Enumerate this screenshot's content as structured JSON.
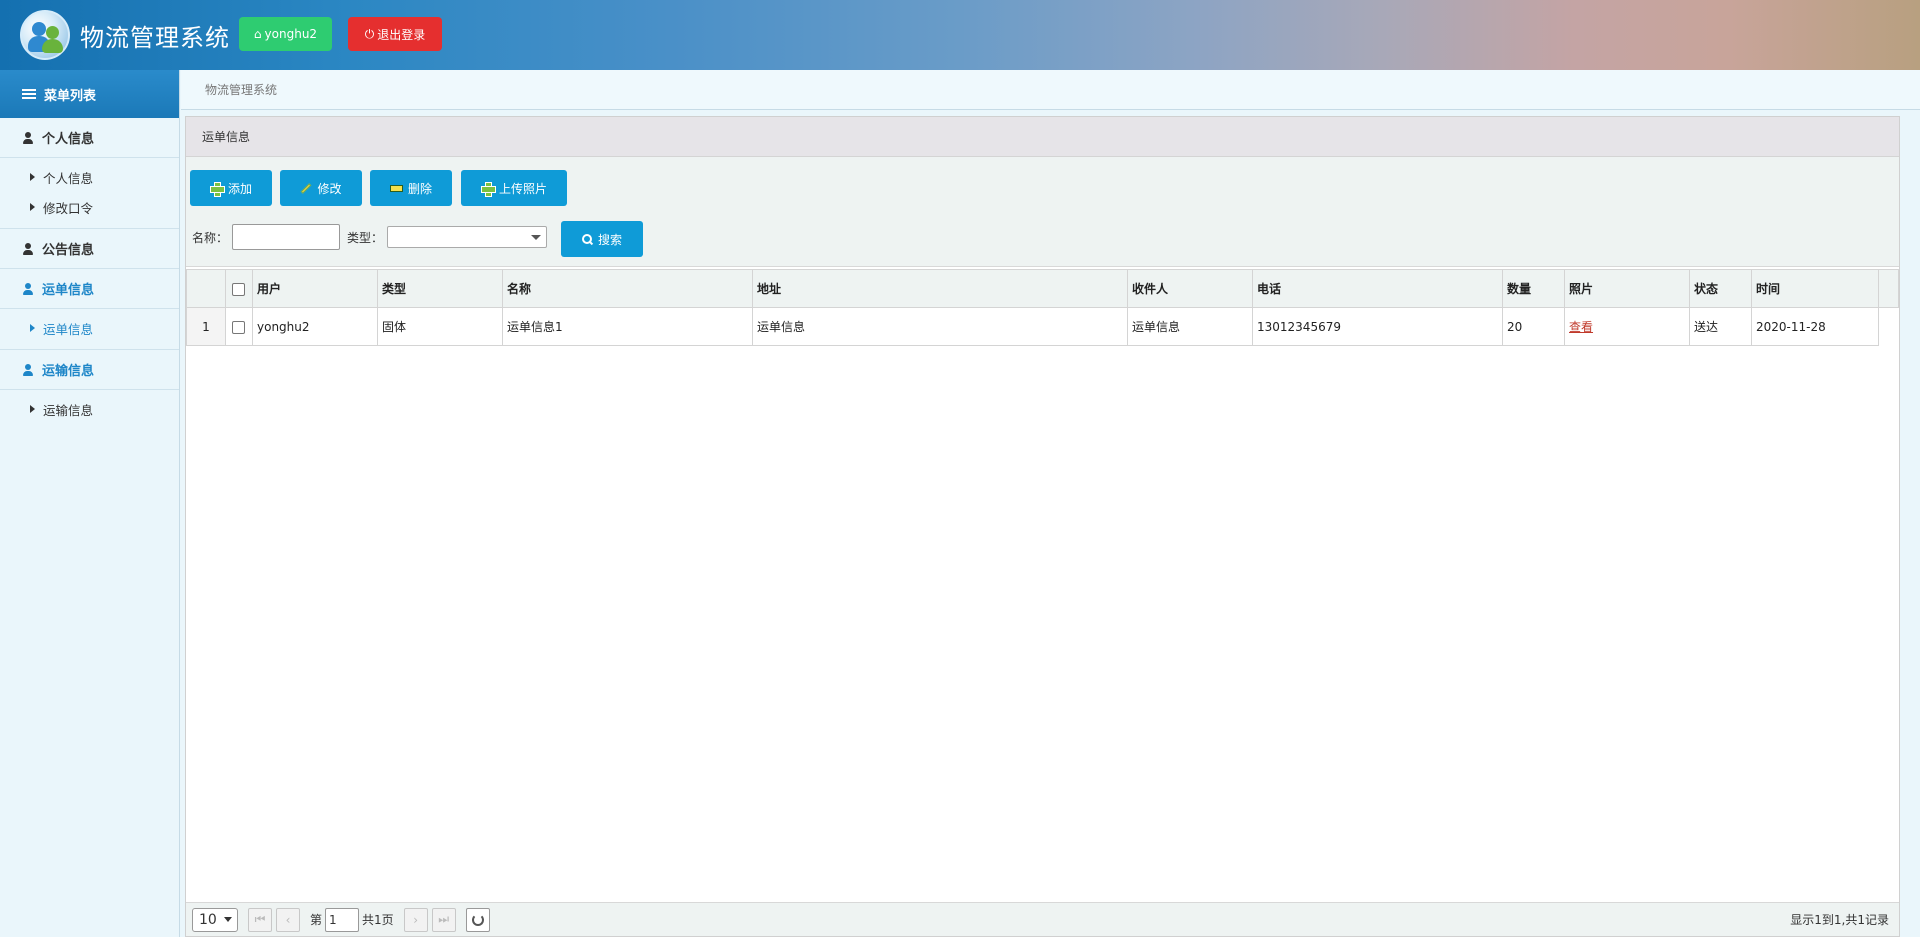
{
  "header": {
    "title": "物流管理系统",
    "user_button": "yonghu2",
    "logout_button": "退出登录",
    "colors": {
      "user_button": "#2ecc71",
      "logout_button": "#e52f2f",
      "accent": "#0f9bd7"
    }
  },
  "sidebar": {
    "title": "菜单列表",
    "groups": [
      {
        "label": "个人信息",
        "items": [
          {
            "label": "个人信息"
          },
          {
            "label": "修改口令"
          }
        ]
      },
      {
        "label": "公告信息",
        "items": []
      },
      {
        "label": "运单信息",
        "items": [
          {
            "label": "运单信息"
          }
        ]
      },
      {
        "label": "运输信息",
        "items": [
          {
            "label": "运输信息"
          }
        ]
      }
    ]
  },
  "breadcrumb": "物流管理系统",
  "panel": {
    "title": "运单信息",
    "buttons": {
      "add": "添加",
      "edit": "修改",
      "delete": "删除",
      "upload": "上传照片"
    },
    "search": {
      "name_label": "名称：",
      "name_value": "",
      "type_label": "类型：",
      "type_value": "",
      "button": "搜索"
    }
  },
  "table": {
    "columns": [
      "用户",
      "类型",
      "名称",
      "地址",
      "收件人",
      "电话",
      "数量",
      "照片",
      "状态",
      "时间"
    ],
    "rows": [
      {
        "index": "1",
        "cells": [
          "yonghu2",
          "固体",
          "运单信息1",
          "运单信息",
          "运单信息",
          "13012345679",
          "20",
          "查看",
          "送达",
          "2020-11-28"
        ]
      }
    ]
  },
  "pager": {
    "page_size": "10",
    "page_prefix": "第",
    "page_value": "1",
    "page_suffix": "共1页",
    "info": "显示1到1,共1记录"
  }
}
